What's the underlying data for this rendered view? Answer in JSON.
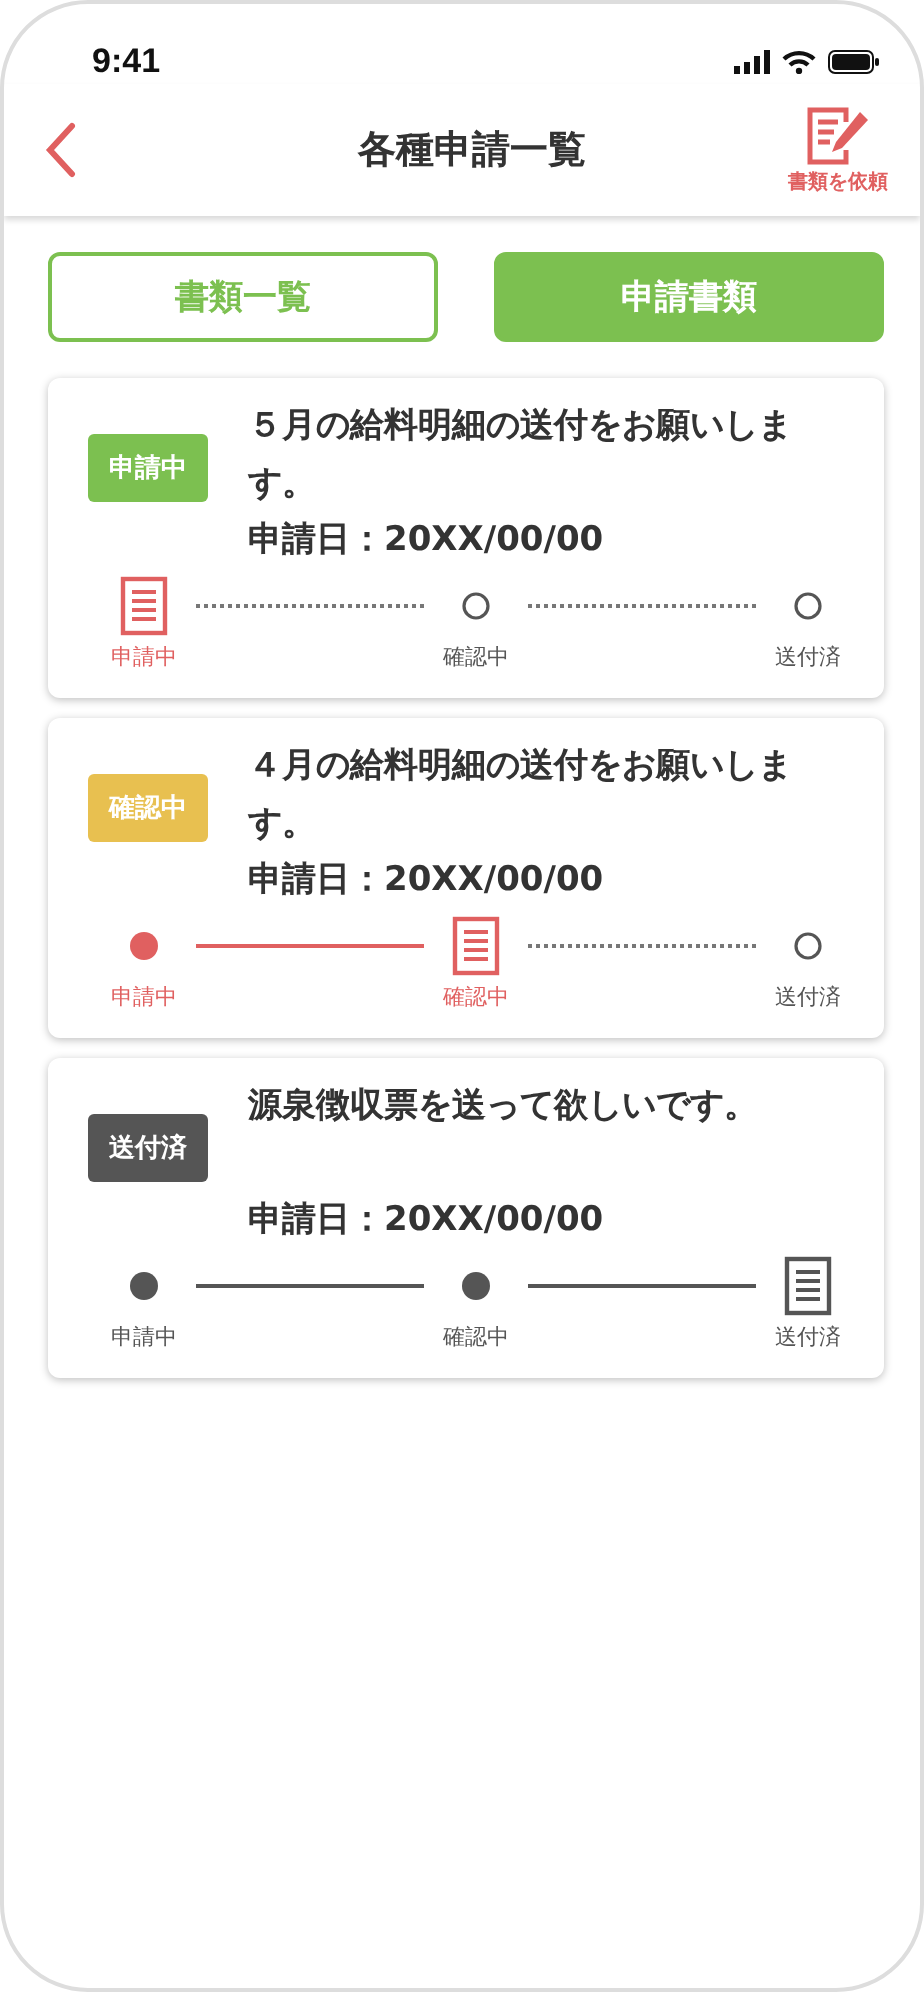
{
  "status_bar": {
    "time": "9:41"
  },
  "header": {
    "title": "各種申請一覧",
    "action_label": "書類を依頼"
  },
  "tabs": [
    {
      "label": "書類一覧",
      "selected": false
    },
    {
      "label": "申請書類",
      "selected": true
    }
  ],
  "requests": [
    {
      "status": {
        "label": "申請中",
        "kind": "applying"
      },
      "title": "５月の給料明細の送付をお願いします。",
      "date": "申請日：20XX/00/00",
      "steps": [
        {
          "label": "申請中",
          "kind": "current"
        },
        {
          "label": "確認中",
          "kind": "pending"
        },
        {
          "label": "送付済",
          "kind": "pending"
        }
      ]
    },
    {
      "status": {
        "label": "確認中",
        "kind": "confirming"
      },
      "title": "４月の給料明細の送付をお願いします。",
      "date": "申請日：20XX/00/00",
      "steps": [
        {
          "label": "申請中",
          "kind": "done"
        },
        {
          "label": "確認中",
          "kind": "current"
        },
        {
          "label": "送付済",
          "kind": "pending"
        }
      ]
    },
    {
      "status": {
        "label": "送付済",
        "kind": "sent"
      },
      "title": "源泉徴収票を送って欲しいです。",
      "date": "申請日：20XX/00/00",
      "steps": [
        {
          "label": "申請中",
          "kind": "done"
        },
        {
          "label": "確認中",
          "kind": "done"
        },
        {
          "label": "送付済",
          "kind": "current"
        }
      ]
    }
  ]
}
